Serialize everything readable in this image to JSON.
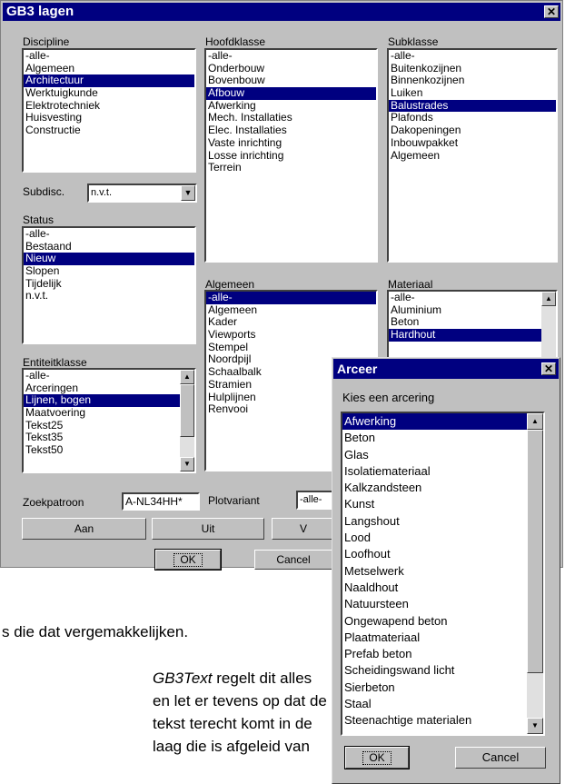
{
  "main": {
    "title": "GB3 lagen",
    "close_glyph": "✕",
    "discipline": {
      "label": "Discipline",
      "items": [
        "-alle-",
        "Algemeen",
        "Architectuur",
        "Werktuigkunde",
        "Elektrotechniek",
        "Huisvesting",
        "Constructie"
      ],
      "selected": 2
    },
    "hoofdklasse": {
      "label": "Hoofdklasse",
      "items": [
        "-alle-",
        "Onderbouw",
        "Bovenbouw",
        "Afbouw",
        "Afwerking",
        "Mech. Installaties",
        "Elec. Installaties",
        "Vaste inrichting",
        "Losse inrichting",
        "Terrein"
      ],
      "selected": 3
    },
    "subklasse": {
      "label": "Subklasse",
      "items": [
        "-alle-",
        "Buitenkozijnen",
        "Binnenkozijnen",
        "Luiken",
        "Balustrades",
        "Plafonds",
        "Dakopeningen",
        "Inbouwpakket",
        "Algemeen"
      ],
      "selected": 4
    },
    "subdisc": {
      "label": "Subdisc.",
      "value": "n.v.t."
    },
    "status": {
      "label": "Status",
      "items": [
        "-alle-",
        "Bestaand",
        "Nieuw",
        "Slopen",
        "Tijdelijk",
        "n.v.t."
      ],
      "selected": 2
    },
    "algemeen": {
      "label": "Algemeen",
      "items": [
        "-alle-",
        "Algemeen",
        "Kader",
        "Viewports",
        "Stempel",
        "Noordpijl",
        "Schaalbalk",
        "Stramien",
        "Hulplijnen",
        "Renvooi"
      ],
      "selected": 0
    },
    "materiaal": {
      "label": "Materiaal",
      "items": [
        "-alle-",
        "Aluminium",
        "Beton",
        "Hardhout"
      ],
      "selected": 3
    },
    "entiteitklasse": {
      "label": "Entiteitklasse",
      "items": [
        "-alle-",
        "Arceringen",
        "Lijnen, bogen",
        "Maatvoering",
        "Tekst25",
        "Tekst35",
        "Tekst50"
      ],
      "selected": 2
    },
    "zoekpatroon": {
      "label": "Zoekpatroon",
      "value": "A-NL34HH*"
    },
    "plotvariant": {
      "label": "Plotvariant",
      "value": "-alle-"
    },
    "buttons": {
      "aan": "Aan",
      "uit": "Uit",
      "third": "V",
      "ok": "OK",
      "cancel": "Cancel"
    }
  },
  "arceer": {
    "title": "Arceer",
    "close_glyph": "✕",
    "prompt": "Kies een arcering",
    "items": [
      "Afwerking",
      "Beton",
      "Glas",
      "Isolatiemateriaal",
      "Kalkzandsteen",
      "Kunst",
      "Langshout",
      "Lood",
      "Loofhout",
      "Metselwerk",
      "Naaldhout",
      "Natuursteen",
      "Ongewapend beton",
      "Plaatmateriaal",
      "Prefab beton",
      "Scheidingswand licht",
      "Sierbeton",
      "Staal",
      "Steenachtige materialen"
    ],
    "selected": 0,
    "ok": "OK",
    "cancel": "Cancel"
  },
  "document": {
    "line1": "s die dat vergemakkelijken.",
    "line2_em": "GB3Text",
    "line2_rest": " regelt dit alles",
    "line3": "en let er tevens op dat de",
    "line4": "tekst terecht komt in de",
    "line5": "laag die is afgeleid van"
  },
  "icons": {
    "close": "close-icon",
    "dropdown": "chevron-down-icon",
    "scroll_up": "scroll-up-arrow-icon",
    "scroll_down": "scroll-down-arrow-icon"
  },
  "colors": {
    "selection": "#000080",
    "face": "#c0c0c0",
    "title": "#000080"
  }
}
